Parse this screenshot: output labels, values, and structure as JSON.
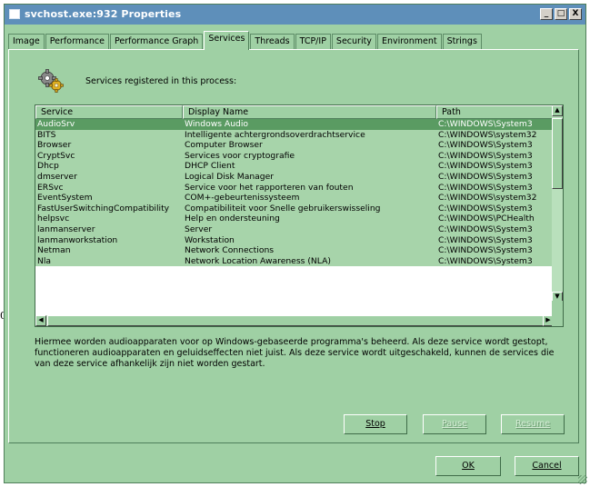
{
  "window": {
    "title": "svchost.exe:932 Properties"
  },
  "titlebar_buttons": [
    "_",
    "□",
    "X"
  ],
  "tabs": [
    "Image",
    "Performance",
    "Performance Graph",
    "Services",
    "Threads",
    "TCP/IP",
    "Security",
    "Environment",
    "Strings"
  ],
  "active_tab": "Services",
  "services_label": "Services registered in this process:",
  "columns": [
    "Service",
    "Display Name",
    "Path"
  ],
  "rows": [
    {
      "service": "AudioSrv",
      "display": "Windows Audio",
      "path": "C:\\WINDOWS\\System3"
    },
    {
      "service": "BITS",
      "display": "Intelligente achtergrondsoverdrachtservice",
      "path": "C:\\WINDOWS\\system32"
    },
    {
      "service": "Browser",
      "display": "Computer Browser",
      "path": "C:\\WINDOWS\\System3"
    },
    {
      "service": "CryptSvc",
      "display": "Services voor cryptografie",
      "path": "C:\\WINDOWS\\System3"
    },
    {
      "service": "Dhcp",
      "display": "DHCP Client",
      "path": "C:\\WINDOWS\\System3"
    },
    {
      "service": "dmserver",
      "display": "Logical Disk Manager",
      "path": "C:\\WINDOWS\\System3"
    },
    {
      "service": "ERSvc",
      "display": "Service voor het rapporteren van fouten",
      "path": "C:\\WINDOWS\\System3"
    },
    {
      "service": "EventSystem",
      "display": "COM+-gebeurtenissysteem",
      "path": "C:\\WINDOWS\\system32"
    },
    {
      "service": "FastUserSwitchingCompatibility",
      "display": "Compatibiliteit voor Snelle gebruikerswisseling",
      "path": "C:\\WINDOWS\\System3"
    },
    {
      "service": "helpsvc",
      "display": "Help en ondersteuning",
      "path": "C:\\WINDOWS\\PCHealth"
    },
    {
      "service": "lanmanserver",
      "display": "Server",
      "path": "C:\\WINDOWS\\System3"
    },
    {
      "service": "lanmanworkstation",
      "display": "Workstation",
      "path": "C:\\WINDOWS\\System3"
    },
    {
      "service": "Netman",
      "display": "Network Connections",
      "path": "C:\\WINDOWS\\System3"
    },
    {
      "service": "Nla",
      "display": "Network Location Awareness (NLA)",
      "path": "C:\\WINDOWS\\System3"
    }
  ],
  "selected_row": 0,
  "description": "Hiermee worden audioapparaten voor op Windows-gebaseerde programma's beheerd. Als deze service wordt gestopt, functioneren audioapparaten en geluidseffecten niet juist. Als deze service wordt uitgeschakeld, kunnen de services die van deze service afhankelijk zijn niet worden gestart.",
  "buttons": {
    "stop": "Stop",
    "pause": "Pause",
    "resume": "Resume",
    "ok": "OK",
    "cancel": "Cancel"
  },
  "stray_char": "0",
  "icons": {
    "services": "gears-icon"
  },
  "colors": {
    "window_bg": "#9fd0a4",
    "selected_row": "#5a9b62",
    "titlebar": "#5e8fba"
  }
}
